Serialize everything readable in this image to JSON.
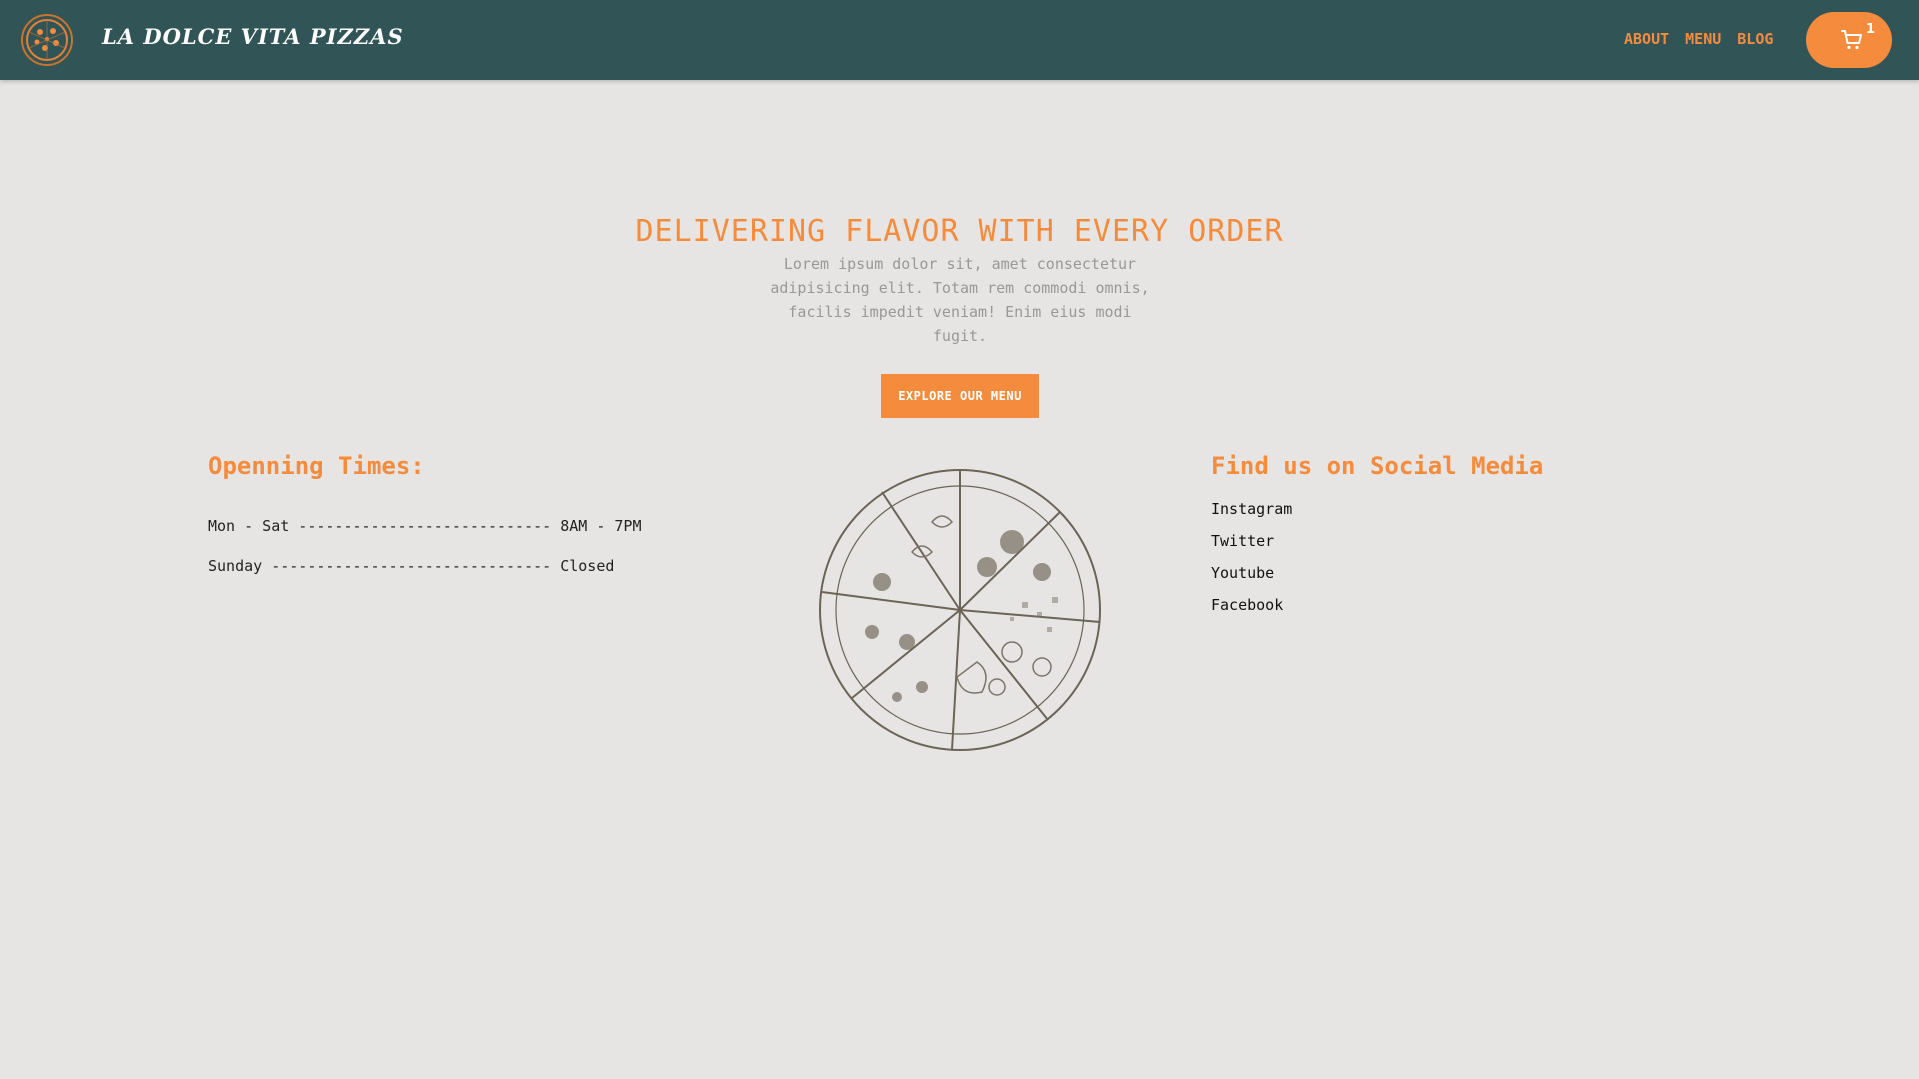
{
  "header": {
    "brand": "LA DOLCE VITA PIZZAS",
    "logo_icon": "pizza-logo-icon",
    "nav": [
      {
        "label": "ABOUT"
      },
      {
        "label": "MENU"
      },
      {
        "label": "BLOG"
      }
    ],
    "cart": {
      "icon": "shopping-cart-icon",
      "count": "1"
    }
  },
  "hero": {
    "title": "DELIVERING FLAVOR WITH EVERY ORDER",
    "text": "Lorem ipsum dolor sit, amet consectetur adipisicing elit. Totam rem commodi omnis, facilis impedit veniam! Enim eius modi fugit.",
    "cta_label": "EXPLORE OUR MENU"
  },
  "hours": {
    "title": "Openning Times:",
    "rows": [
      "Mon - Sat ---------------------------- 8AM - 7PM",
      "Sunday ------------------------------- Closed"
    ]
  },
  "illustration": {
    "icon": "pizza-sketch-illustration"
  },
  "social": {
    "title": "Find us on Social Media",
    "links": [
      "Instagram",
      "Twitter",
      "Youtube",
      "Facebook"
    ]
  },
  "colors": {
    "header_bg": "#315456",
    "accent": "#f58b3c",
    "page_bg": "#e7e5e3",
    "muted_text": "#9a9896"
  }
}
